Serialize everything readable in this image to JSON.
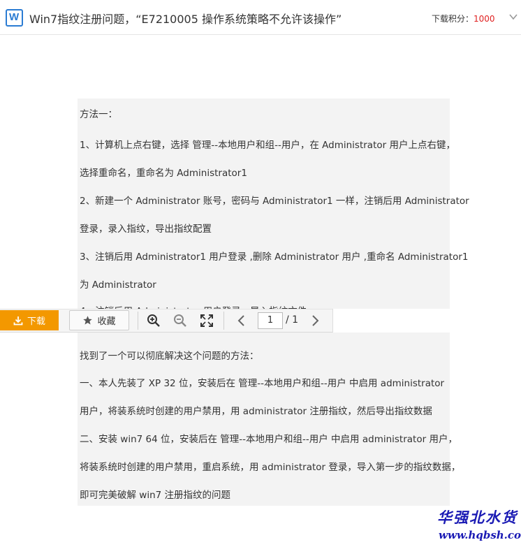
{
  "header": {
    "app_icon": "word-doc-icon",
    "title": "Win7指纹注册问题，“E7210005 操作系统策略不允许该操作”",
    "points_label": "下载积分：",
    "points_value": "1000",
    "collapse_icon": "chevron-down-icon"
  },
  "document": {
    "paragraphs_top": [
      "方法一：",
      "1、计算机上点右键，选择  管理--本地用户和组--用户，在 Administrator 用户上点右键，",
      "选择重命名，重命名为 Administrator1",
      "2、新建一个 Administrator 账号，密码与 Administrator1 一样，注销后用 Administrator",
      "登录，录入指纹，导出指纹配置",
      "3、注销后用 Administrator1 用户登录 ,删除 Administrator 用户 ,重命名 Administrator1",
      "为 Administrator",
      "4、注销后用 Administrator 用户登录，导入指纹文件"
    ],
    "paragraphs_bottom": [
      "找到了一个可以彻底解决这个问题的方法：",
      "一、本人先装了 XP 32 位，安装后在  管理--本地用户和组--用户  中启用 administrator",
      "用户，将装系统时创建的用户禁用，用 administrator 注册指纹，然后导出指纹数据",
      "二、安装 win7 64 位，安装后在  管理--本地用户和组--用户  中启用 administrator 用户，",
      "将装系统时创建的用户禁用，重启系统，用 administrator 登录，导入第一步的指纹数据，",
      "即可完美破解 win7 注册指纹的问题"
    ]
  },
  "toolbar": {
    "download_label": "下载",
    "download_icon": "download-icon",
    "favorite_label": "收藏",
    "favorite_icon": "star-icon",
    "zoom_in_icon": "zoom-in-icon",
    "zoom_out_icon": "zoom-out-icon",
    "fullscreen_icon": "fullscreen-icon",
    "prev_icon": "chevron-left-icon",
    "next_icon": "chevron-right-icon",
    "current_page": "1",
    "total_pages": "/ 1"
  },
  "watermark": {
    "line1": "华强北水货",
    "line2": "www.hqbsh.com"
  },
  "colors": {
    "accent_orange": "#f39800",
    "points_red": "#e02020",
    "word_blue": "#2b7cd3",
    "watermark_blue": "#1a1ab4"
  }
}
